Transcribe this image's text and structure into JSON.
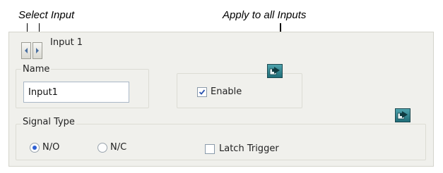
{
  "callouts": {
    "select_input": "Select Input",
    "apply_all": "Apply to all Inputs"
  },
  "input_header": {
    "title": "Input 1",
    "prev_icon": "chevron-left-icon",
    "next_icon": "chevron-right-icon"
  },
  "name_group": {
    "label": "Name",
    "value": "Input1"
  },
  "enable_group": {
    "label": "Enable",
    "checked": true
  },
  "signal_type": {
    "label": "Signal Type",
    "options": [
      {
        "label": "N/O",
        "selected": true
      },
      {
        "label": "N/C",
        "selected": false
      }
    ],
    "latch_label": "Latch Trigger",
    "latch_checked": false
  },
  "apply_icon": "apply-to-all-icon",
  "colors": {
    "panel_bg": "#f0f0ec",
    "radio_selected": "#2d5fd3",
    "apply_icon": "#2f8c98"
  }
}
